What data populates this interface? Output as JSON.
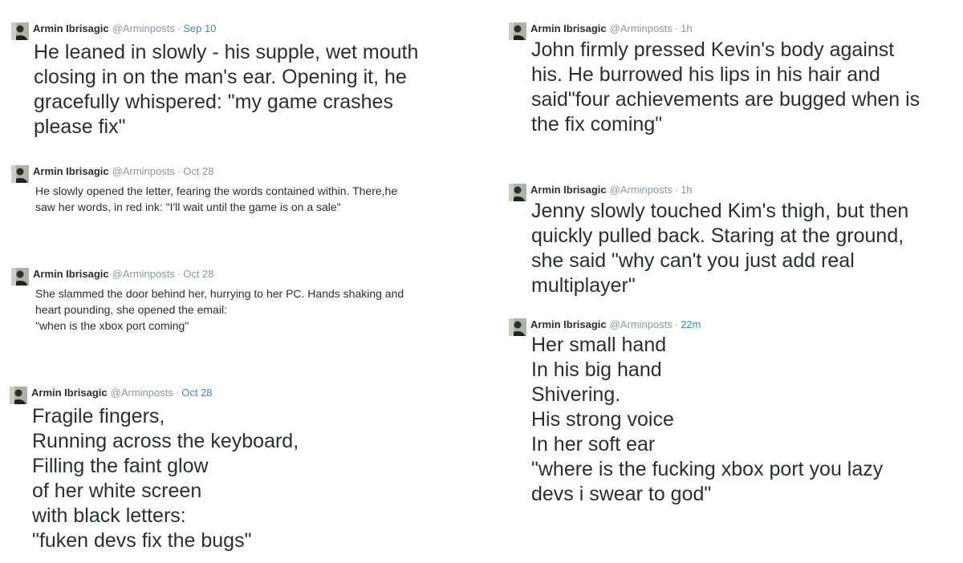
{
  "colors": {
    "text": "#292f33",
    "meta_grey": "#8899a6",
    "link_blue": "#3b88c3",
    "background": "#ffffff"
  },
  "tweets": [
    {
      "author": "Armin Ibrisagic",
      "handle": "@Arminposts",
      "separator": "·",
      "time": "Sep 10",
      "avatar_icon": "profile-photo-icon",
      "text": "He leaned in slowly - his supple, wet mouth\nclosing in on the man's ear. Opening it, he\ngracefully whispered: \"my game crashes\nplease fix\""
    },
    {
      "author": "Armin Ibrisagic",
      "handle": "@Arminposts",
      "separator": "·",
      "time": "Oct 28",
      "avatar_icon": "profile-photo-icon",
      "text": "He slowly opened the letter, fearing the words contained within. There,he\nsaw her words, in red ink: \"I'll wait until the game is on a sale\""
    },
    {
      "author": "Armin Ibrisagic",
      "handle": "@Arminposts",
      "separator": "·",
      "time": "Oct 28",
      "avatar_icon": "profile-photo-icon",
      "text": "She slammed the door behind her, hurrying to her PC. Hands shaking and\nheart pounding, she opened the email:\n\"when is the xbox port coming\""
    },
    {
      "author": "Armin Ibrisagic",
      "handle": "@Arminposts",
      "separator": "·",
      "time": "Oct 28",
      "avatar_icon": "profile-photo-icon",
      "text": "Fragile fingers,\nRunning across the keyboard,\nFilling the faint glow\nof her white screen\nwith black letters:\n\"fuken devs fix the bugs\""
    },
    {
      "author": "Armin Ibrisagic",
      "handle": "@Arminposts",
      "separator": "·",
      "time": "1h",
      "avatar_icon": "profile-photo-icon",
      "text": "John firmly pressed Kevin's body against\nhis. He burrowed his lips in his hair and\nsaid\"four achievements are bugged when is\nthe fix coming\""
    },
    {
      "author": "Armin Ibrisagic",
      "handle": "@Arminposts",
      "separator": "·",
      "time": "1h",
      "avatar_icon": "profile-photo-icon",
      "text": "Jenny slowly touched Kim's thigh, but then\nquickly pulled back. Staring at the ground,\nshe said \"why can't you just add real\nmultiplayer\""
    },
    {
      "author": "Armin Ibrisagic",
      "handle": "@Arminposts",
      "separator": "·",
      "time": "22m",
      "avatar_icon": "profile-photo-icon",
      "text": "Her small hand\nIn his big hand\nShivering.\nHis strong voice\nIn her soft ear\n\"where is the fucking xbox port you lazy\ndevs i swear to god\""
    }
  ]
}
